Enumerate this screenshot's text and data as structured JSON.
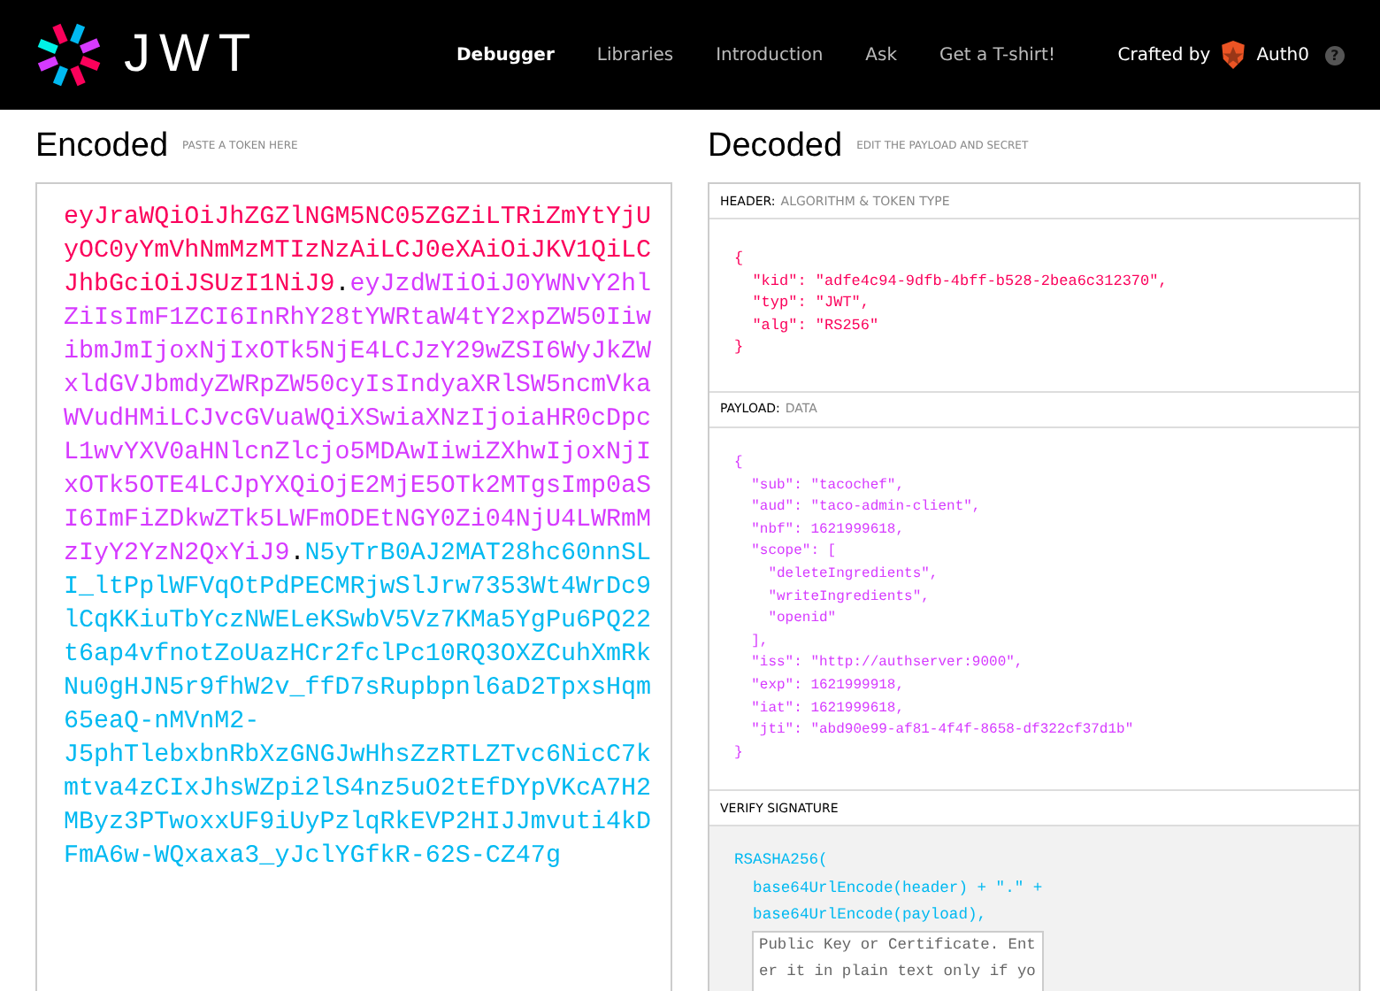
{
  "nav": {
    "logo_text": "JWT",
    "links": [
      {
        "label": "Debugger",
        "selected": true
      },
      {
        "label": "Libraries",
        "selected": false
      },
      {
        "label": "Introduction",
        "selected": false
      },
      {
        "label": "Ask",
        "selected": false
      },
      {
        "label": "Get a T-shirt!",
        "selected": false
      }
    ],
    "crafted_by": "Crafted by",
    "brand": "Auth0",
    "help": "?"
  },
  "encoded": {
    "title": "Encoded",
    "subtitle": "PASTE A TOKEN HERE",
    "lines": [
      [
        {
          "kind": "header",
          "text": "eyJraWQiOiJhZGZlNGM5NC05ZGZiLTRiZmYtYjU"
        }
      ],
      [
        {
          "kind": "header",
          "text": "yOC0yYmVhNmMzMTIzNzAiLCJ0eXAiOiJKV1QiLC"
        }
      ],
      [
        {
          "kind": "header",
          "text": "JhbGciOiJSUzI1NiJ9"
        },
        {
          "kind": "dot",
          "text": "."
        },
        {
          "kind": "payload",
          "text": "eyJzdWIiOiJ0YWNvY2hl"
        }
      ],
      [
        {
          "kind": "payload",
          "text": "ZiIsImF1ZCI6InRhY28tYWRtaW4tY2xpZW50Iiw"
        }
      ],
      [
        {
          "kind": "payload",
          "text": "ibmJmIjoxNjIxOTk5NjE4LCJzY29wZSI6WyJkZW"
        }
      ],
      [
        {
          "kind": "payload",
          "text": "xldGVJbmdyZWRpZW50cyIsIndyaXRlSW5ncmVka"
        }
      ],
      [
        {
          "kind": "payload",
          "text": "WVudHMiLCJvcGVuaWQiXSwiaXNzIjoiaHR0cDpc"
        }
      ],
      [
        {
          "kind": "payload",
          "text": "L1wvYXV0aHNlcnZlcjo5MDAwIiwiZXhwIjoxNjI"
        }
      ],
      [
        {
          "kind": "payload",
          "text": "xOTk5OTE4LCJpYXQiOjE2MjE5OTk2MTgsImp0aS"
        }
      ],
      [
        {
          "kind": "payload",
          "text": "I6ImFiZDkwZTk5LWFmODEtNGY0Zi04NjU4LWRmM"
        }
      ],
      [
        {
          "kind": "payload",
          "text": "zIyY2YzN2QxYiJ9"
        },
        {
          "kind": "dot",
          "text": "."
        },
        {
          "kind": "signature",
          "text": "N5yTrB0AJ2MAT28hc60nnSL"
        }
      ],
      [
        {
          "kind": "signature",
          "text": "I_ltPplWFVqOtPdPECMRjwSlJrw7353Wt4WrDc9"
        }
      ],
      [
        {
          "kind": "signature",
          "text": "lCqKKiuTbYczNWELeKSwbV5Vz7KMa5YgPu6PQ22"
        }
      ],
      [
        {
          "kind": "signature",
          "text": "t6ap4vfnotZoUazHCr2fclPc10RQ3OXZCuhXmRk"
        }
      ],
      [
        {
          "kind": "signature",
          "text": "Nu0gHJN5r9fhW2v_ffD7sRupbpnl6aD2TpxsHqm"
        }
      ],
      [
        {
          "kind": "signature",
          "text": "65eaQ-nMVnM2-"
        }
      ],
      [
        {
          "kind": "signature",
          "text": "J5phTlebxbnRbXzGNGJwHhsZzRTLZTvc6NicC7k"
        }
      ],
      [
        {
          "kind": "signature",
          "text": "mtva4zCIxJhsWZpi2lS4nz5uO2tEfDYpVKcA7H2"
        }
      ],
      [
        {
          "kind": "signature",
          "text": "MByz3PTwoxxUF9iUyPzlqRkEVP2HIJJmvuti4kD"
        }
      ],
      [
        {
          "kind": "signature",
          "text": "FmA6w-WQxaxa3_yJclYGfkR-62S-CZ47g"
        }
      ]
    ]
  },
  "decoded": {
    "title": "Decoded",
    "subtitle": "EDIT THE PAYLOAD AND SECRET",
    "sections": [
      {
        "kind": "header",
        "label": "HEADER:",
        "note": "ALGORITHM & TOKEN TYPE",
        "code": "{\n  \"kid\": \"adfe4c94-9dfb-4bff-b528-2bea6c312370\",\n  \"typ\": \"JWT\",\n  \"alg\": \"RS256\"\n}"
      },
      {
        "kind": "payload",
        "label": "PAYLOAD:",
        "note": "DATA",
        "code": "{\n  \"sub\": \"tacochef\",\n  \"aud\": \"taco-admin-client\",\n  \"nbf\": 1621999618,\n  \"scope\": [\n    \"deleteIngredients\",\n    \"writeIngredients\",\n    \"openid\"\n  ],\n  \"iss\": \"http://authserver:9000\",\n  \"exp\": 1621999918,\n  \"iat\": 1621999618,\n  \"jti\": \"abd90e99-af81-4f4f-8658-df322cf37d1b\"\n}"
      },
      {
        "kind": "verify",
        "label": "VERIFY SIGNATURE",
        "code": "RSASHA256(\n  base64UrlEncode(header) + \".\" +\n  base64UrlEncode(payload),",
        "key_placeholder": "Public Key or Certificate. Enter it in plain text only if yo"
      }
    ]
  }
}
